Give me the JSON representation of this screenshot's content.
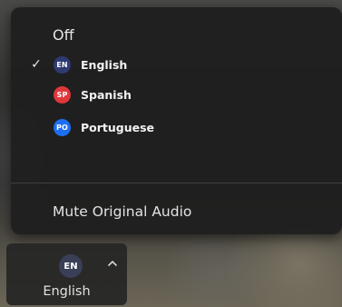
{
  "menu": {
    "off_label": "Off",
    "checkmark": "✓",
    "languages": [
      {
        "code": "EN",
        "name": "English",
        "color": "#2f3a73",
        "selected": true
      },
      {
        "code": "SP",
        "name": "Spanish",
        "color": "#e0373b",
        "selected": false
      },
      {
        "code": "PO",
        "name": "Portuguese",
        "color": "#1d6ef2",
        "selected": false
      }
    ],
    "mute_label": "Mute Original Audio"
  },
  "toolbar": {
    "language_button": {
      "code": "EN",
      "label": "English",
      "badge_color": "#3a3f58",
      "caret_icon": "chevron-up-icon"
    }
  }
}
